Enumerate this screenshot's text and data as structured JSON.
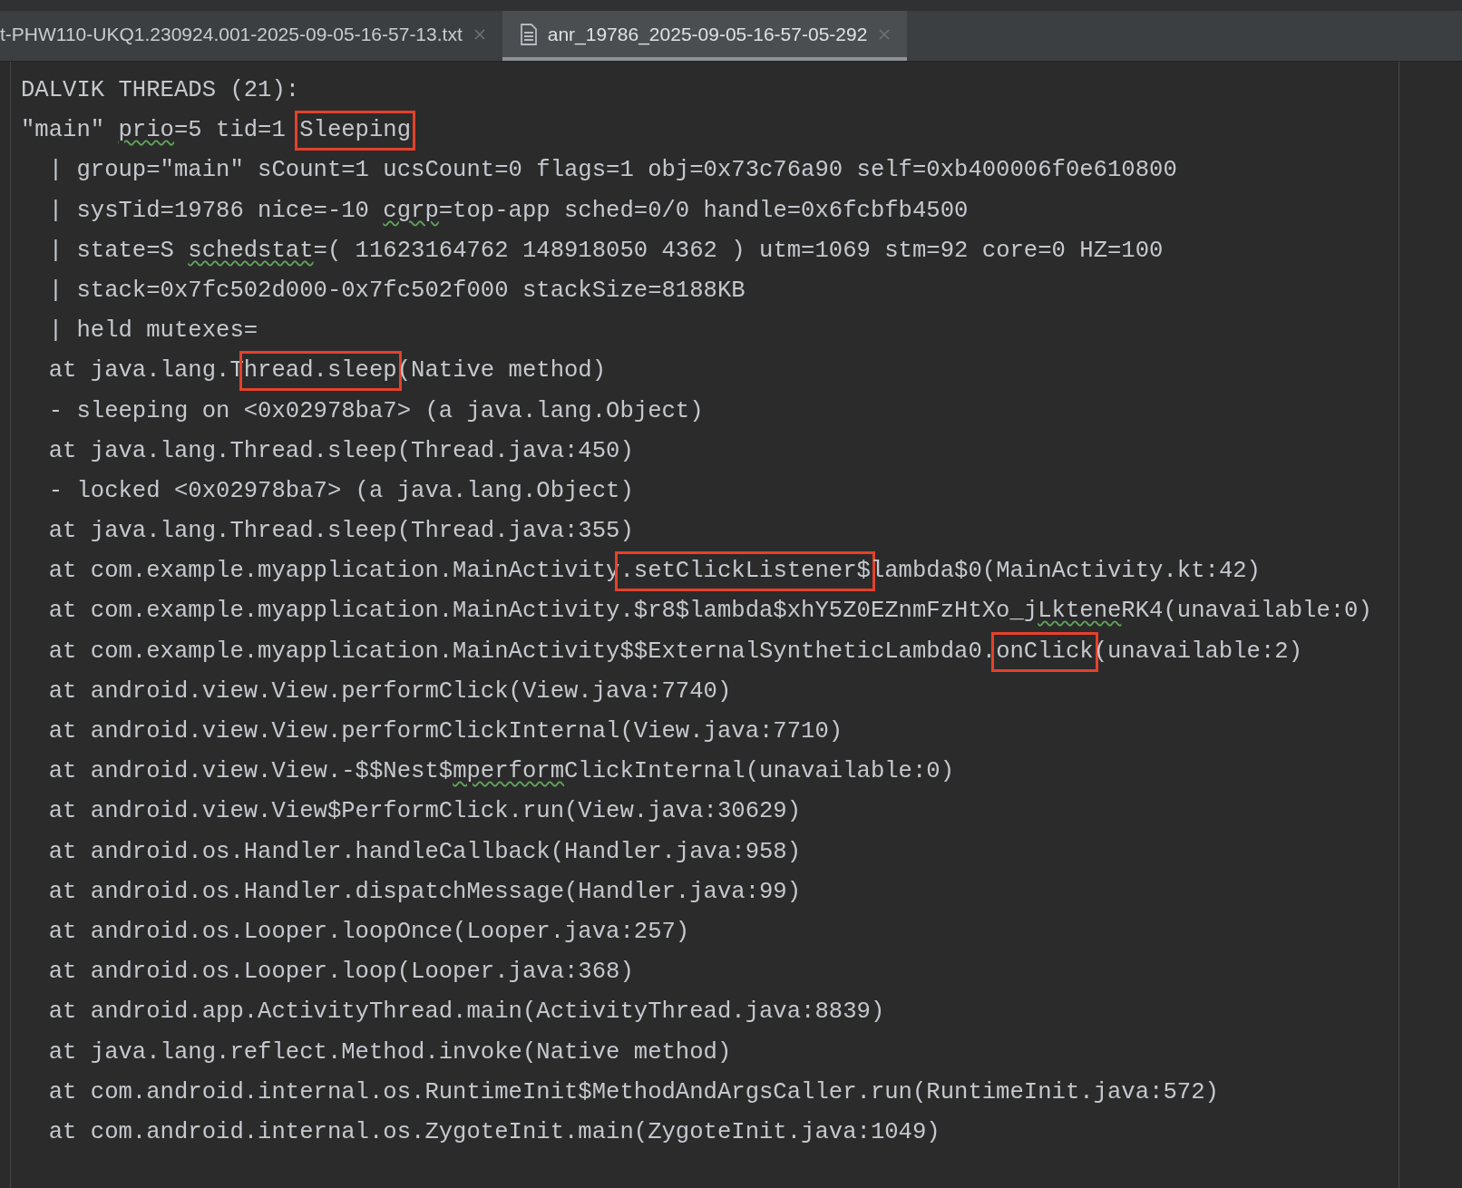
{
  "tabs": [
    {
      "label": "t-PHW110-UKQ1.230924.001-2025-09-05-16-57-13.txt",
      "selected": false,
      "file_icon": false
    },
    {
      "label": "anr_19786_2025-09-05-16-57-05-292",
      "selected": true,
      "file_icon": true
    }
  ],
  "editor": {
    "lines": [
      {
        "segments": [
          {
            "kind": "plain",
            "text": "DALVIK THREADS (21):"
          }
        ]
      },
      {
        "segments": [
          {
            "kind": "plain",
            "text": "\"main\" "
          },
          {
            "kind": "squiggle",
            "text": "prio"
          },
          {
            "kind": "plain",
            "text": "=5 tid=1 "
          },
          {
            "kind": "boxed",
            "text": "Sleeping"
          }
        ]
      },
      {
        "segments": [
          {
            "kind": "plain",
            "text": "  | group=\"main\" sCount=1 ucsCount=0 flags=1 obj=0x73c76a90 self=0xb400006f0e610800"
          }
        ]
      },
      {
        "segments": [
          {
            "kind": "plain",
            "text": "  | sysTid=19786 nice=-10 "
          },
          {
            "kind": "squiggle",
            "text": "cgrp"
          },
          {
            "kind": "plain",
            "text": "=top-app sched=0/0 handle=0x6fcbfb4500"
          }
        ]
      },
      {
        "segments": [
          {
            "kind": "plain",
            "text": "  | state=S "
          },
          {
            "kind": "squiggle",
            "text": "schedstat"
          },
          {
            "kind": "plain",
            "text": "=( 11623164762 148918050 4362 ) utm=1069 stm=92 core=0 HZ=100"
          }
        ]
      },
      {
        "segments": [
          {
            "kind": "plain",
            "text": "  | stack=0x7fc502d000-0x7fc502f000 stackSize=8188KB"
          }
        ]
      },
      {
        "segments": [
          {
            "kind": "plain",
            "text": "  | held mutexes="
          }
        ]
      },
      {
        "segments": [
          {
            "kind": "plain",
            "text": "  at java.lang.T"
          },
          {
            "kind": "boxed",
            "text": "hread.sleep"
          },
          {
            "kind": "plain",
            "text": "(Native method)"
          }
        ]
      },
      {
        "segments": [
          {
            "kind": "plain",
            "text": "  - sleeping on <0x02978ba7> (a java.lang.Object)"
          }
        ]
      },
      {
        "segments": [
          {
            "kind": "plain",
            "text": "  at java.lang.Thread.sleep(Thread.java:450)"
          }
        ]
      },
      {
        "segments": [
          {
            "kind": "plain",
            "text": "  - locked <0x02978ba7> (a java.lang.Object)"
          }
        ]
      },
      {
        "segments": [
          {
            "kind": "plain",
            "text": "  at java.lang.Thread.sleep(Thread.java:355)"
          }
        ]
      },
      {
        "segments": [
          {
            "kind": "plain",
            "text": "  at com.example.myapplication.MainActivity"
          },
          {
            "kind": "boxed",
            "text": ".setClickListener$"
          },
          {
            "kind": "plain",
            "text": "lambda$0(MainActivity.kt:42)"
          }
        ]
      },
      {
        "segments": [
          {
            "kind": "plain",
            "text": "  at com.example.myapplication.MainActivity.$r8$lambda$xhY5Z0EZnmFzHtXo_j"
          },
          {
            "kind": "squiggle",
            "text": "Lktene"
          },
          {
            "kind": "plain",
            "text": "RK4(unavailable:0)"
          }
        ]
      },
      {
        "segments": [
          {
            "kind": "plain",
            "text": "  at com.example.myapplication.MainActivity$$ExternalSyntheticLambda0."
          },
          {
            "kind": "boxed",
            "text": "onClick"
          },
          {
            "kind": "plain",
            "text": "(unavailable:2)"
          }
        ]
      },
      {
        "segments": [
          {
            "kind": "plain",
            "text": "  at android.view.View.performClick(View.java:7740)"
          }
        ]
      },
      {
        "segments": [
          {
            "kind": "plain",
            "text": "  at android.view.View.performClickInternal(View.java:7710)"
          }
        ]
      },
      {
        "segments": [
          {
            "kind": "plain",
            "text": "  at android.view.View.-$$Nest$"
          },
          {
            "kind": "squiggle",
            "text": "mperform"
          },
          {
            "kind": "plain",
            "text": "ClickInternal(unavailable:0)"
          }
        ]
      },
      {
        "segments": [
          {
            "kind": "plain",
            "text": "  at android.view.View$PerformClick.run(View.java:30629)"
          }
        ]
      },
      {
        "segments": [
          {
            "kind": "plain",
            "text": "  at android.os.Handler.handleCallback(Handler.java:958)"
          }
        ]
      },
      {
        "segments": [
          {
            "kind": "plain",
            "text": "  at android.os.Handler.dispatchMessage(Handler.java:99)"
          }
        ]
      },
      {
        "segments": [
          {
            "kind": "plain",
            "text": "  at android.os.Looper.loopOnce(Looper.java:257)"
          }
        ]
      },
      {
        "segments": [
          {
            "kind": "plain",
            "text": "  at android.os.Looper.loop(Looper.java:368)"
          }
        ]
      },
      {
        "segments": [
          {
            "kind": "plain",
            "text": "  at android.app.ActivityThread.main(ActivityThread.java:8839)"
          }
        ]
      },
      {
        "segments": [
          {
            "kind": "plain",
            "text": "  at java.lang.reflect.Method.invoke(Native method)"
          }
        ]
      },
      {
        "segments": [
          {
            "kind": "plain",
            "text": "  at com.android.internal.os.RuntimeInit$MethodAndArgsCaller.run(RuntimeInit.java:572)"
          }
        ]
      },
      {
        "segments": [
          {
            "kind": "plain",
            "text": "  at com.android.internal.os.ZygoteInit.main(ZygoteInit.java:1049)"
          }
        ]
      }
    ]
  }
}
